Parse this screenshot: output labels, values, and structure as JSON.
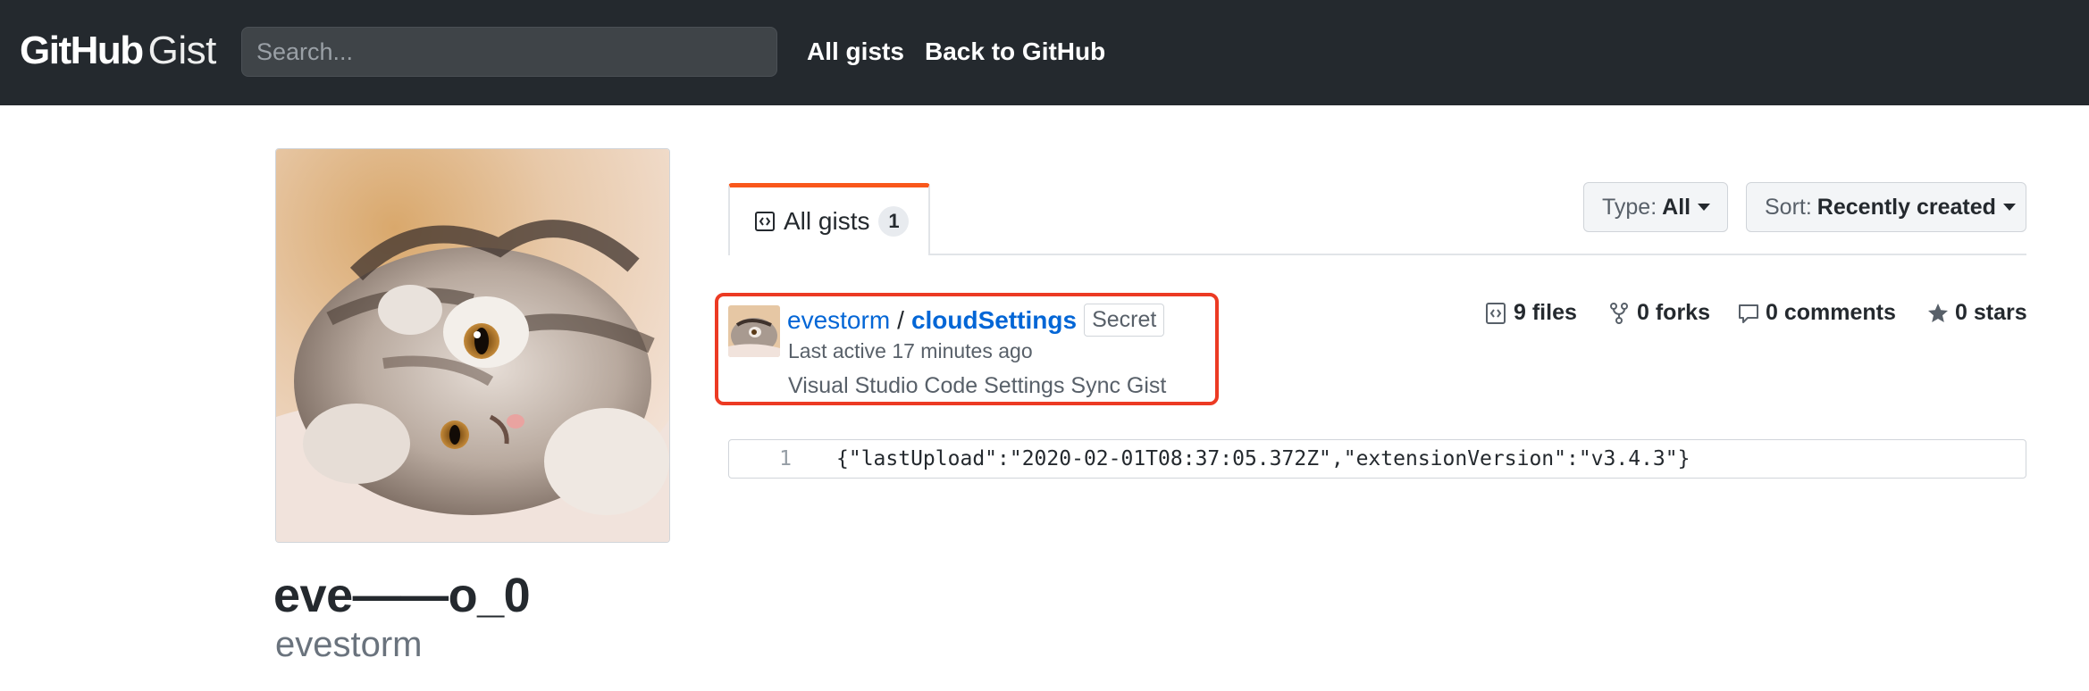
{
  "header": {
    "logo_primary": "GitHub",
    "logo_secondary": "Gist",
    "search_placeholder": "Search...",
    "nav": [
      "All gists",
      "Back to GitHub"
    ]
  },
  "profile": {
    "display_name": "eve——o_0",
    "login": "evestorm",
    "avatar": "cat-photo"
  },
  "tabs": {
    "active_label": "All gists",
    "active_count": "1"
  },
  "filters": {
    "type_label": "Type:",
    "type_value": "All",
    "sort_label": "Sort:",
    "sort_value": "Recently created"
  },
  "gist": {
    "owner": "evestorm",
    "separator": "/",
    "name": "cloudSettings",
    "badge": "Secret",
    "last_active": "Last active 17 minutes ago",
    "description": "Visual Studio Code Settings Sync Gist",
    "stats": {
      "files": "9 files",
      "forks": "0 forks",
      "comments": "0 comments",
      "stars": "0 stars"
    },
    "preview": {
      "line_number": "1",
      "code": "{\"lastUpload\":\"2020-02-01T08:37:05.372Z\",\"extensionVersion\":\"v3.4.3\"}"
    }
  },
  "colors": {
    "header_bg": "#24292e",
    "link_blue": "#0366d6",
    "tab_accent": "#f9571b",
    "highlight_red": "#ec3a23"
  }
}
